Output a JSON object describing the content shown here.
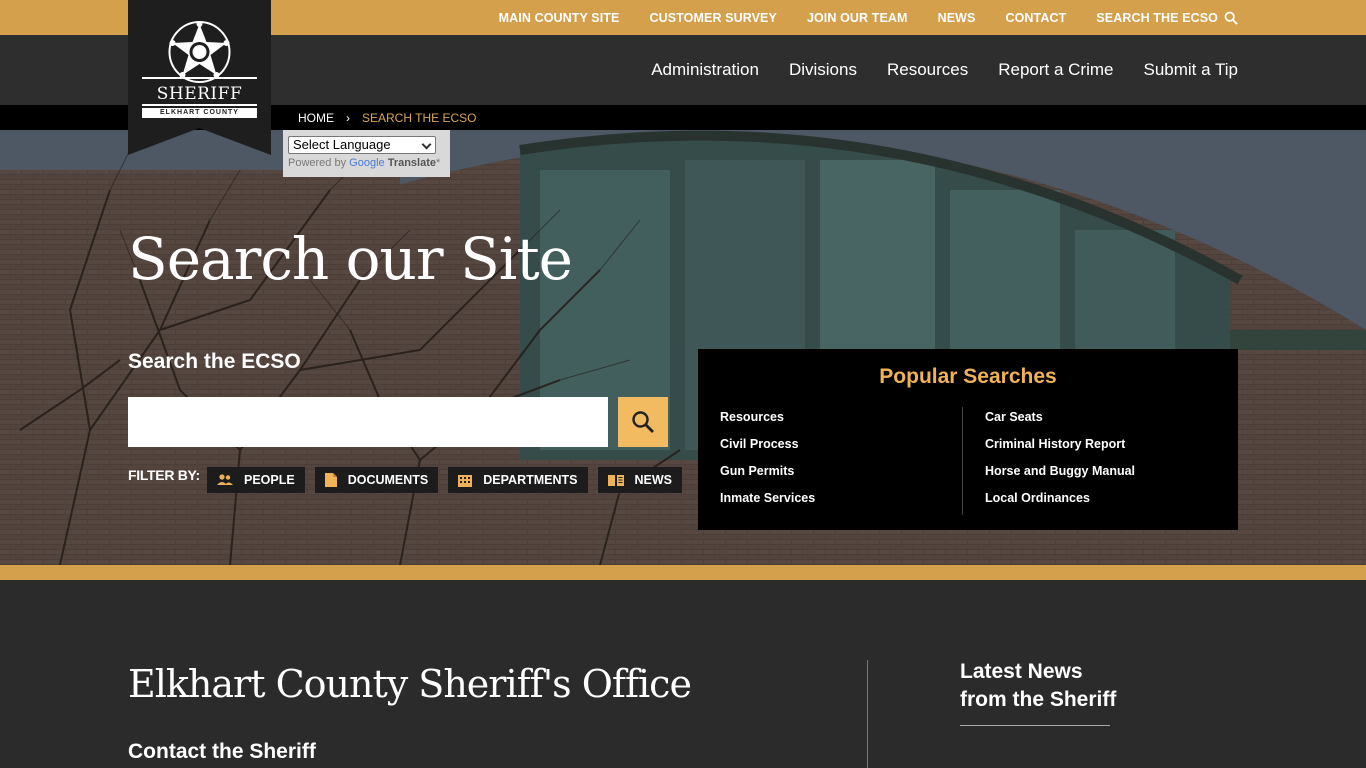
{
  "colors": {
    "gold": "#d4a04c",
    "accent": "#f0b256",
    "dark": "#2e2e2e",
    "black": "#000000"
  },
  "logo": {
    "word": "SHERIFF",
    "sub": "ELKHART COUNTY"
  },
  "topbar": {
    "items": [
      "MAIN COUNTY SITE",
      "CUSTOMER SURVEY",
      "JOIN OUR TEAM",
      "NEWS",
      "CONTACT",
      "SEARCH THE ECSO"
    ],
    "search_icon": "search-icon"
  },
  "mainnav": {
    "items": [
      "Administration",
      "Divisions",
      "Resources",
      "Report a Crime",
      "Submit a Tip"
    ]
  },
  "breadcrumb": {
    "home": "HOME",
    "separator": "›",
    "current": "SEARCH THE ECSO"
  },
  "translate": {
    "selected": "Select Language",
    "powered_by": "Powered by",
    "google": "Google",
    "translate": "Translate",
    "asterisk": "*"
  },
  "hero": {
    "title": "Search our Site",
    "search_label": "Search the ECSO",
    "search_value": "",
    "filter_label": "FILTER BY:",
    "filters": [
      {
        "label": "PEOPLE",
        "icon": "people-icon"
      },
      {
        "label": "DOCUMENTS",
        "icon": "document-icon"
      },
      {
        "label": "DEPARTMENTS",
        "icon": "building-icon"
      },
      {
        "label": "NEWS",
        "icon": "newspaper-icon"
      }
    ]
  },
  "popular": {
    "title": "Popular Searches",
    "left": [
      "Resources",
      "Civil Process",
      "Gun Permits",
      "Inmate Services"
    ],
    "right": [
      "Car Seats",
      "Criminal History Report",
      "Horse and Buggy Manual",
      "Local Ordinances"
    ]
  },
  "footer": {
    "org": "Elkhart County Sheriff's Office",
    "contact": "Contact the Sheriff",
    "news_line1": "Latest News",
    "news_line2": "from the Sheriff"
  }
}
